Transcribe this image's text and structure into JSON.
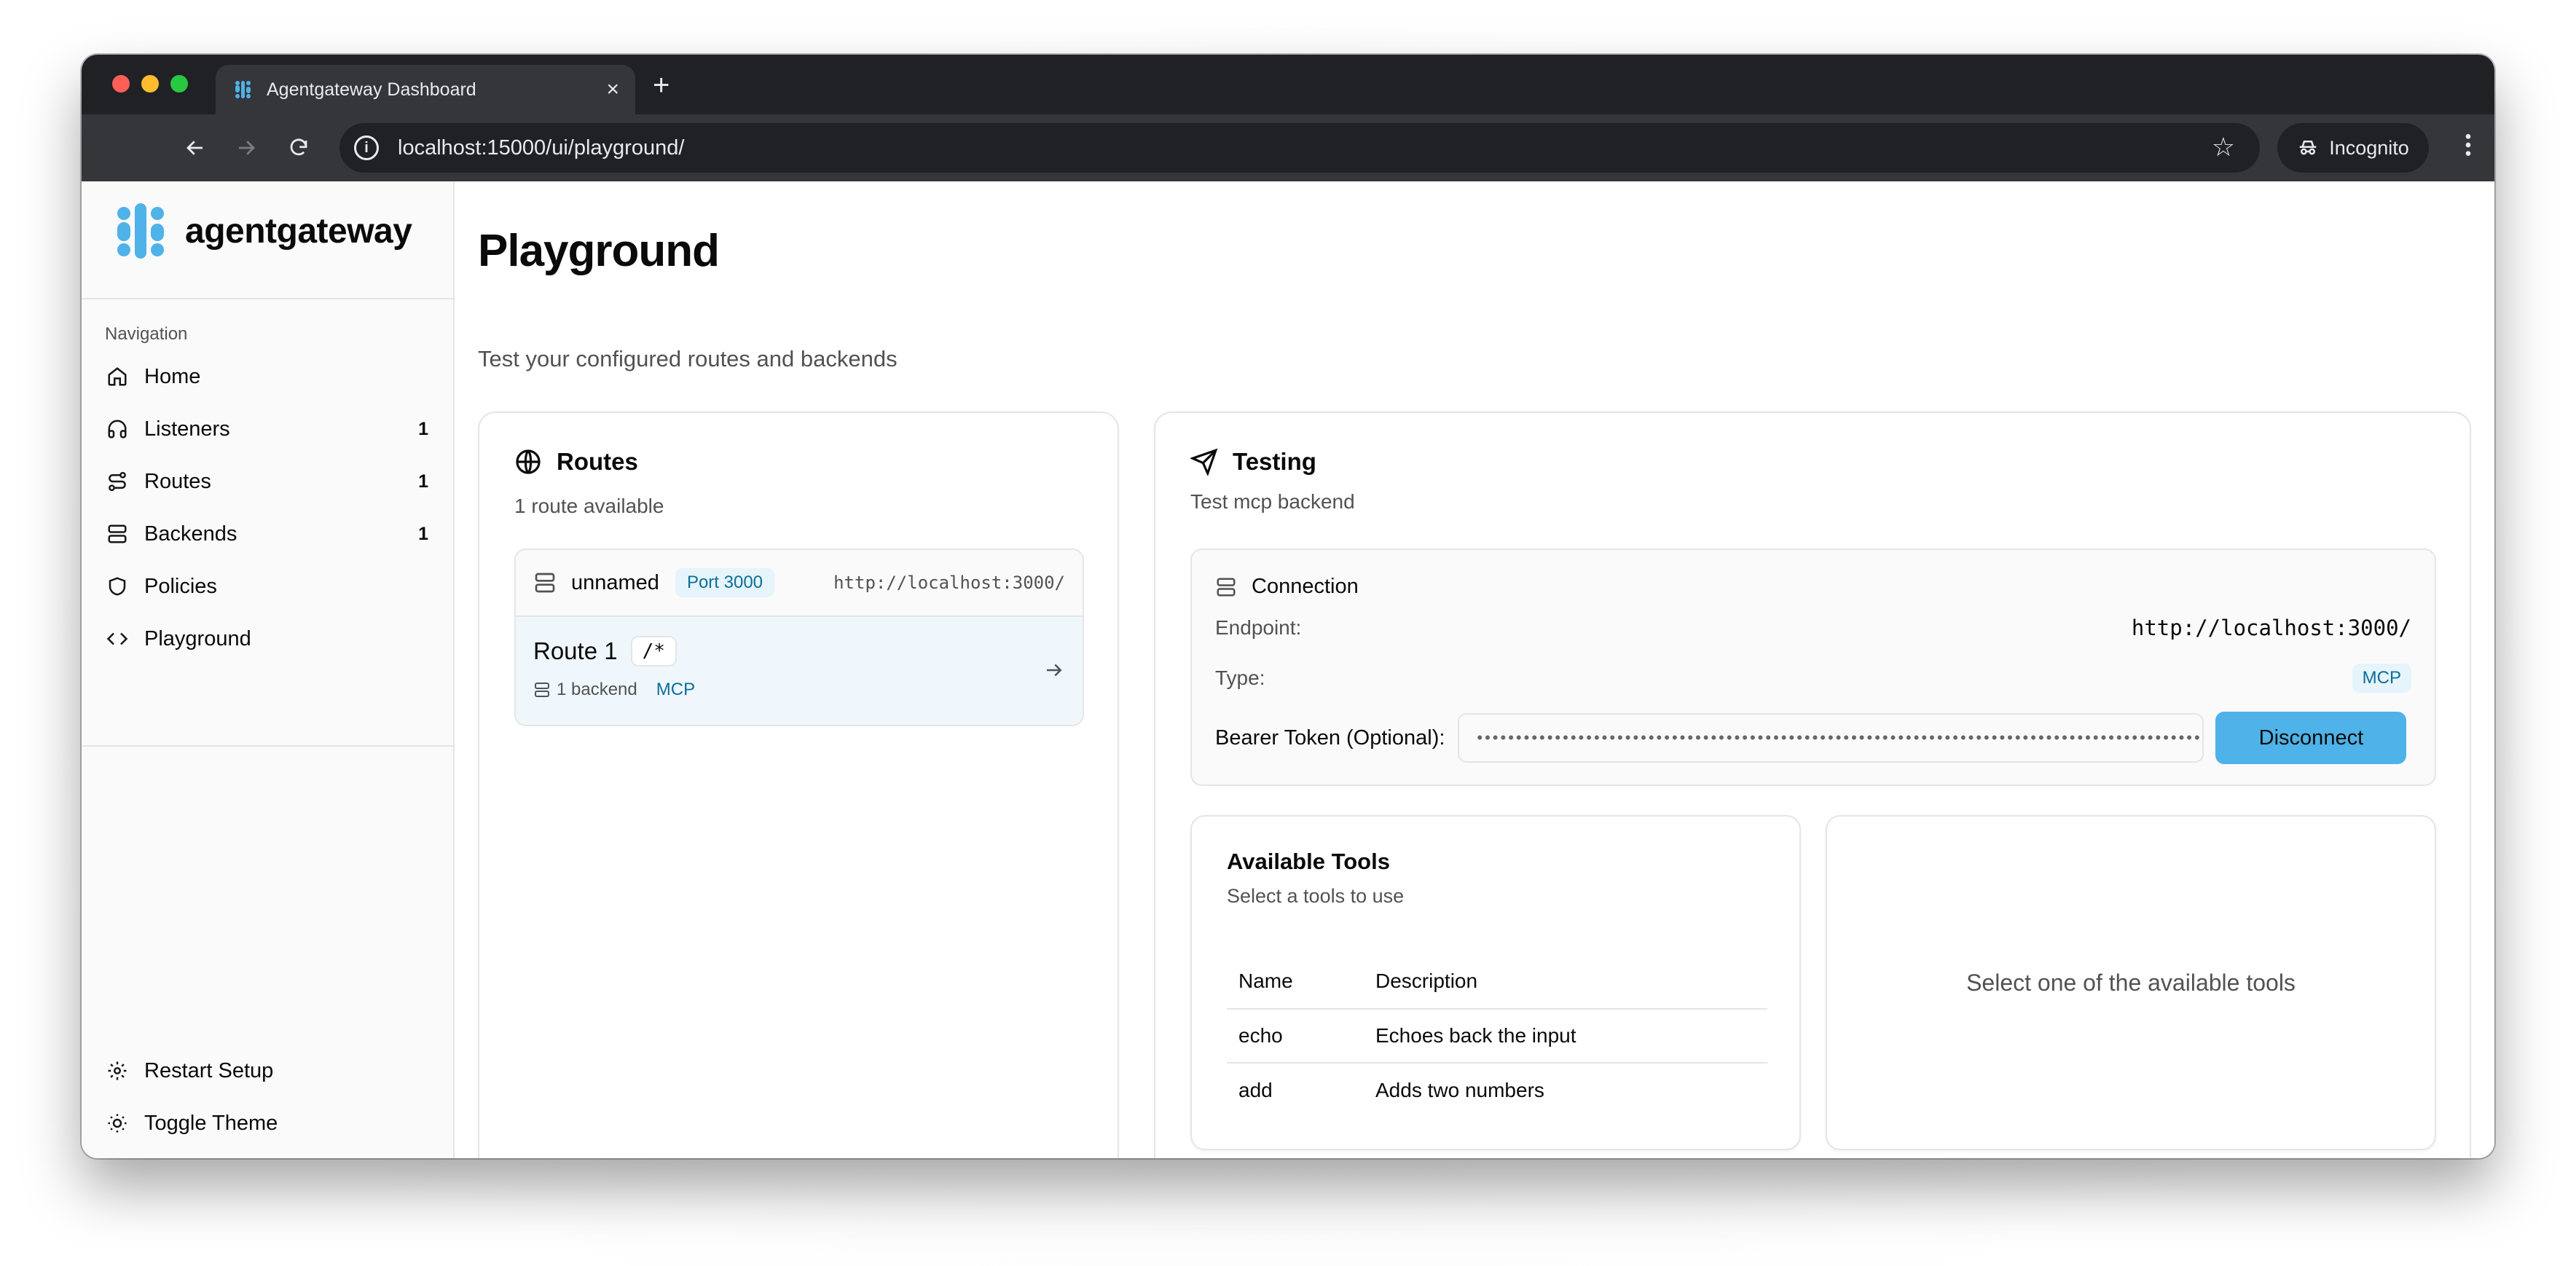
{
  "browser": {
    "tab_title": "Agentgateway Dashboard",
    "url": "localhost:15000/ui/playground/",
    "incognito_label": "Incognito"
  },
  "brand": {
    "name": "agentgateway",
    "accent": "#4fb2e8"
  },
  "sidebar": {
    "heading": "Navigation",
    "items": [
      {
        "label": "Home",
        "count": ""
      },
      {
        "label": "Listeners",
        "count": "1"
      },
      {
        "label": "Routes",
        "count": "1"
      },
      {
        "label": "Backends",
        "count": "1"
      },
      {
        "label": "Policies",
        "count": ""
      },
      {
        "label": "Playground",
        "count": ""
      }
    ],
    "footer": [
      {
        "label": "Restart Setup"
      },
      {
        "label": "Toggle Theme"
      }
    ]
  },
  "page": {
    "title": "Playground",
    "subtitle": "Test your configured routes and backends"
  },
  "routes_card": {
    "title": "Routes",
    "subtitle": "1 route available",
    "listener": {
      "name": "unnamed",
      "port": "Port 3000",
      "url": "http://localhost:3000/"
    },
    "route": {
      "name": "Route 1",
      "path": "/*",
      "backends": "1 backend",
      "protocol": "MCP"
    }
  },
  "testing_card": {
    "title": "Testing",
    "subtitle": "Test mcp backend",
    "connection": {
      "title": "Connection",
      "endpoint_label": "Endpoint:",
      "endpoint_value": "http://localhost:3000/",
      "type_label": "Type:",
      "type_value": "MCP",
      "token_label": "Bearer Token (Optional):",
      "token_value": "••••••••••••••••••••••••••••••••••••••••••••••••••••••••••••••••••••••••••••••••••••••••••••••••••••••••••••••••••••••••••••",
      "disconnect_label": "Disconnect"
    },
    "tools": {
      "title": "Available Tools",
      "subtitle": "Select a tools to use",
      "columns": [
        "Name",
        "Description"
      ],
      "rows": [
        {
          "name": "echo",
          "description": "Echoes back the input"
        },
        {
          "name": "add",
          "description": "Adds two numbers"
        }
      ]
    },
    "empty_state": "Select one of the available tools"
  }
}
